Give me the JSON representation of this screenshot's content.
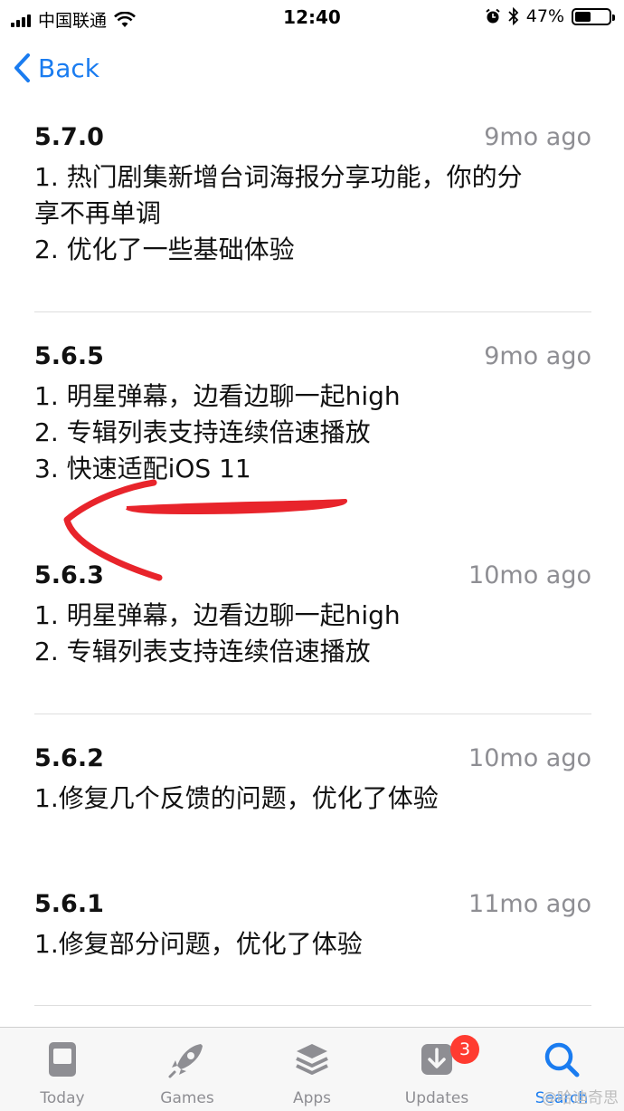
{
  "status_bar": {
    "carrier": "中国联通",
    "time": "12:40",
    "battery_percent": "47%",
    "battery_level": 0.47
  },
  "nav": {
    "back_label": "Back"
  },
  "versions": [
    {
      "version": "5.7.0",
      "date": "9mo ago",
      "notes": "1. 热门剧集新增台词海报分享功能，你的分\n享不再单调\n2. 优化了一些基础体验"
    },
    {
      "version": "5.6.5",
      "date": "9mo ago",
      "notes": "1. 明星弹幕，边看边聊一起high\n2. 专辑列表支持连续倍速播放\n3. 快速适配iOS 11"
    },
    {
      "version": "5.6.3",
      "date": "10mo ago",
      "notes": "1. 明星弹幕，边看边聊一起high\n2. 专辑列表支持连续倍速播放"
    },
    {
      "version": "5.6.2",
      "date": "10mo ago",
      "notes": "1.修复几个反馈的问题，优化了体验"
    },
    {
      "version": "5.6.1",
      "date": "11mo ago",
      "notes": "1.修复部分问题，优化了体验"
    }
  ],
  "annotation_color": "#e8242b",
  "accent_color": "#1a7cf0",
  "tab_bar": {
    "tabs": [
      {
        "label": "Today",
        "icon": "today-icon"
      },
      {
        "label": "Games",
        "icon": "rocket-icon"
      },
      {
        "label": "Apps",
        "icon": "layers-icon"
      },
      {
        "label": "Updates",
        "icon": "download-icon",
        "badge": "3"
      },
      {
        "label": "Search",
        "icon": "search-icon",
        "active": true
      }
    ],
    "watermark": "@哈迪奇思"
  }
}
